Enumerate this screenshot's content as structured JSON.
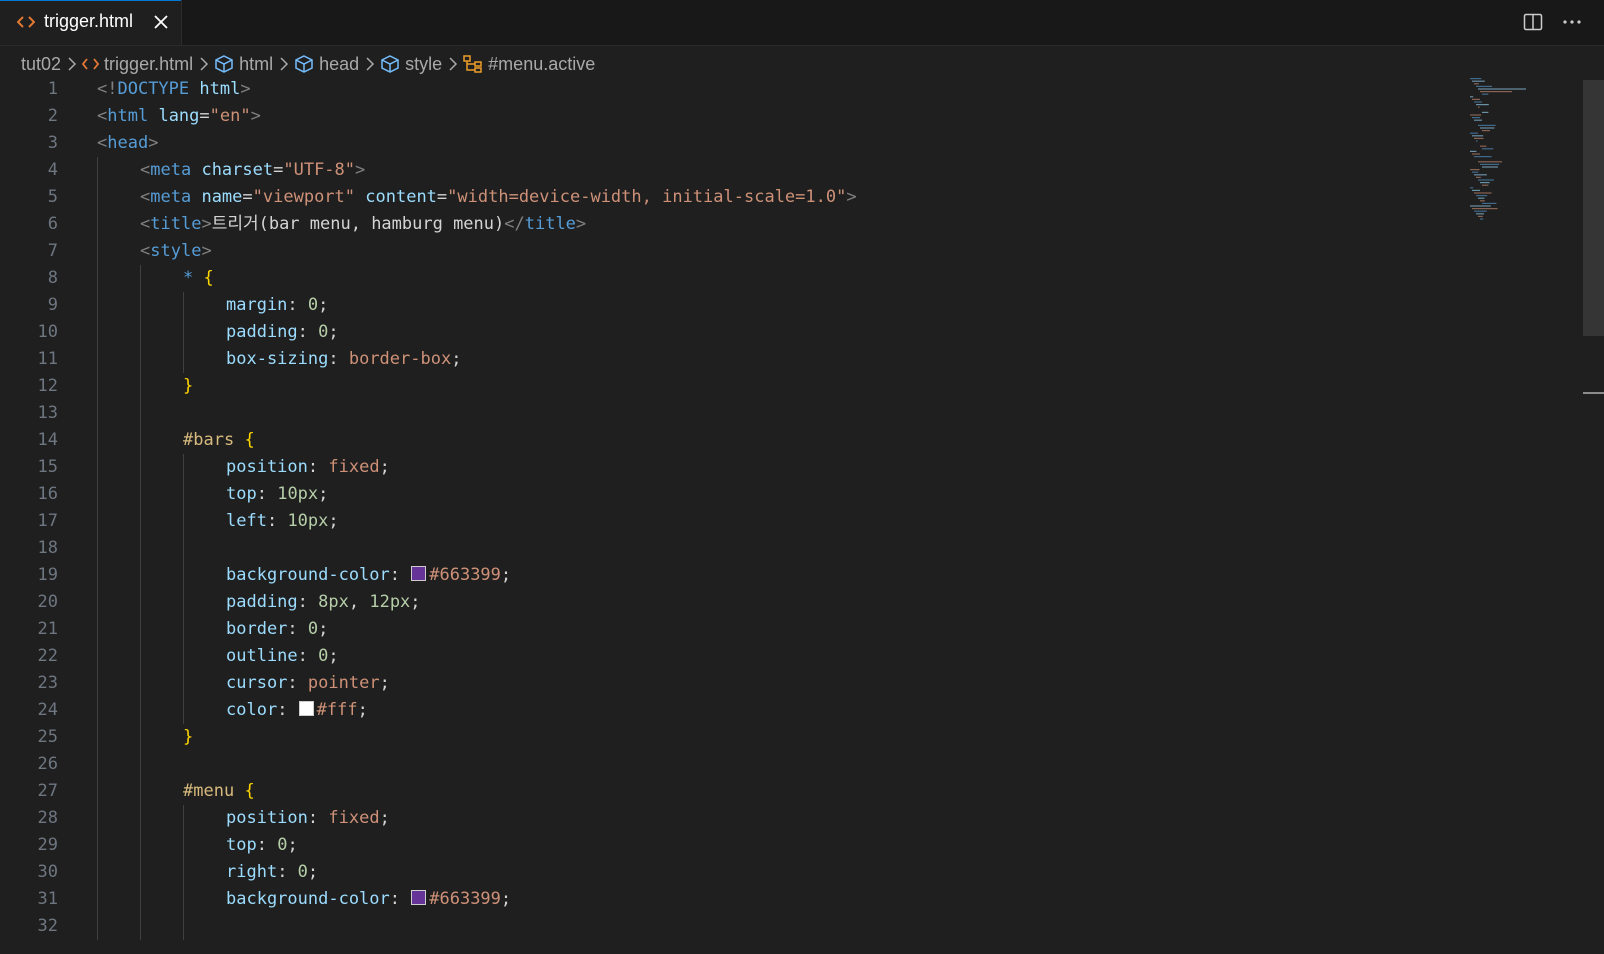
{
  "tab": {
    "filename": "trigger.html",
    "file_icon": "html-file-icon",
    "close_icon": "close-icon"
  },
  "toolbar": {
    "split_icon": "split-editor-icon",
    "more_icon": "more-actions-icon"
  },
  "breadcrumb": [
    {
      "label": "tut02",
      "icon": ""
    },
    {
      "label": "trigger.html",
      "icon": "html-file-icon"
    },
    {
      "label": "html",
      "icon": "element-icon"
    },
    {
      "label": "head",
      "icon": "element-icon"
    },
    {
      "label": "style",
      "icon": "element-icon"
    },
    {
      "label": "#menu.active",
      "icon": "selector-icon"
    }
  ],
  "colors": {
    "editor_bg": "#1f1f1f",
    "tabbar_bg": "#181818",
    "swatch_purple": "#663399",
    "swatch_white": "#ffffff"
  },
  "code_lines": [
    {
      "n": "1",
      "indent": 0,
      "tokens": [
        [
          "t-punc",
          "<!"
        ],
        [
          "t-tag",
          "DOCTYPE"
        ],
        [
          "t-plain",
          " "
        ],
        [
          "t-attr",
          "html"
        ],
        [
          "t-punc",
          ">"
        ]
      ]
    },
    {
      "n": "2",
      "indent": 0,
      "tokens": [
        [
          "t-punc",
          "<"
        ],
        [
          "t-tag",
          "html"
        ],
        [
          "t-plain",
          " "
        ],
        [
          "t-attr",
          "lang"
        ],
        [
          "t-plain",
          "="
        ],
        [
          "t-str",
          "\"en\""
        ],
        [
          "t-punc",
          ">"
        ]
      ]
    },
    {
      "n": "3",
      "indent": 0,
      "tokens": [
        [
          "t-punc",
          "<"
        ],
        [
          "t-tag",
          "head"
        ],
        [
          "t-punc",
          ">"
        ]
      ]
    },
    {
      "n": "4",
      "indent": 1,
      "tokens": [
        [
          "t-punc",
          "<"
        ],
        [
          "t-tag",
          "meta"
        ],
        [
          "t-plain",
          " "
        ],
        [
          "t-attr",
          "charset"
        ],
        [
          "t-plain",
          "="
        ],
        [
          "t-str",
          "\"UTF-8\""
        ],
        [
          "t-punc",
          ">"
        ]
      ]
    },
    {
      "n": "5",
      "indent": 1,
      "tokens": [
        [
          "t-punc",
          "<"
        ],
        [
          "t-tag",
          "meta"
        ],
        [
          "t-plain",
          " "
        ],
        [
          "t-attr",
          "name"
        ],
        [
          "t-plain",
          "="
        ],
        [
          "t-str",
          "\"viewport\""
        ],
        [
          "t-plain",
          " "
        ],
        [
          "t-attr",
          "content"
        ],
        [
          "t-plain",
          "="
        ],
        [
          "t-str",
          "\"width=device-width, initial-scale=1.0\""
        ],
        [
          "t-punc",
          ">"
        ]
      ]
    },
    {
      "n": "6",
      "indent": 1,
      "tokens": [
        [
          "t-punc",
          "<"
        ],
        [
          "t-tag",
          "title"
        ],
        [
          "t-punc",
          ">"
        ],
        [
          "t-text",
          "트리거(bar menu, hamburg menu)"
        ],
        [
          "t-punc",
          "</"
        ],
        [
          "t-tag",
          "title"
        ],
        [
          "t-punc",
          ">"
        ]
      ]
    },
    {
      "n": "7",
      "indent": 1,
      "tokens": [
        [
          "t-punc",
          "<"
        ],
        [
          "t-tag",
          "style"
        ],
        [
          "t-punc",
          ">"
        ]
      ]
    },
    {
      "n": "8",
      "indent": 2,
      "tokens": [
        [
          "t-tag",
          "*"
        ],
        [
          "t-plain",
          " "
        ],
        [
          "t-brace",
          "{"
        ]
      ]
    },
    {
      "n": "9",
      "indent": 3,
      "tokens": [
        [
          "t-prop",
          "margin"
        ],
        [
          "t-plain",
          ": "
        ],
        [
          "t-num",
          "0"
        ],
        [
          "t-plain",
          ";"
        ]
      ]
    },
    {
      "n": "10",
      "indent": 3,
      "tokens": [
        [
          "t-prop",
          "padding"
        ],
        [
          "t-plain",
          ": "
        ],
        [
          "t-num",
          "0"
        ],
        [
          "t-plain",
          ";"
        ]
      ]
    },
    {
      "n": "11",
      "indent": 3,
      "tokens": [
        [
          "t-prop",
          "box-sizing"
        ],
        [
          "t-plain",
          ": "
        ],
        [
          "t-val",
          "border-box"
        ],
        [
          "t-plain",
          ";"
        ]
      ]
    },
    {
      "n": "12",
      "indent": 2,
      "tokens": [
        [
          "t-brace",
          "}"
        ]
      ]
    },
    {
      "n": "13",
      "indent": 2,
      "tokens": []
    },
    {
      "n": "14",
      "indent": 2,
      "tokens": [
        [
          "t-sel",
          "#bars"
        ],
        [
          "t-plain",
          " "
        ],
        [
          "t-brace",
          "{"
        ]
      ]
    },
    {
      "n": "15",
      "indent": 3,
      "tokens": [
        [
          "t-prop",
          "position"
        ],
        [
          "t-plain",
          ": "
        ],
        [
          "t-val",
          "fixed"
        ],
        [
          "t-plain",
          ";"
        ]
      ]
    },
    {
      "n": "16",
      "indent": 3,
      "tokens": [
        [
          "t-prop",
          "top"
        ],
        [
          "t-plain",
          ": "
        ],
        [
          "t-num",
          "10px"
        ],
        [
          "t-plain",
          ";"
        ]
      ]
    },
    {
      "n": "17",
      "indent": 3,
      "tokens": [
        [
          "t-prop",
          "left"
        ],
        [
          "t-plain",
          ": "
        ],
        [
          "t-num",
          "10px"
        ],
        [
          "t-plain",
          ";"
        ]
      ]
    },
    {
      "n": "18",
      "indent": 3,
      "tokens": []
    },
    {
      "n": "19",
      "indent": 3,
      "tokens": [
        [
          "t-prop",
          "background-color"
        ],
        [
          "t-plain",
          ": "
        ],
        [
          "swatch",
          "#663399"
        ],
        [
          "t-val",
          "#663399"
        ],
        [
          "t-plain",
          ";"
        ]
      ]
    },
    {
      "n": "20",
      "indent": 3,
      "tokens": [
        [
          "t-prop",
          "padding"
        ],
        [
          "t-plain",
          ": "
        ],
        [
          "t-num",
          "8px"
        ],
        [
          "t-plain",
          ", "
        ],
        [
          "t-num",
          "12px"
        ],
        [
          "t-plain",
          ";"
        ]
      ]
    },
    {
      "n": "21",
      "indent": 3,
      "tokens": [
        [
          "t-prop",
          "border"
        ],
        [
          "t-plain",
          ": "
        ],
        [
          "t-num",
          "0"
        ],
        [
          "t-plain",
          ";"
        ]
      ]
    },
    {
      "n": "22",
      "indent": 3,
      "tokens": [
        [
          "t-prop",
          "outline"
        ],
        [
          "t-plain",
          ": "
        ],
        [
          "t-num",
          "0"
        ],
        [
          "t-plain",
          ";"
        ]
      ]
    },
    {
      "n": "23",
      "indent": 3,
      "tokens": [
        [
          "t-prop",
          "cursor"
        ],
        [
          "t-plain",
          ": "
        ],
        [
          "t-val",
          "pointer"
        ],
        [
          "t-plain",
          ";"
        ]
      ]
    },
    {
      "n": "24",
      "indent": 3,
      "tokens": [
        [
          "t-prop",
          "color"
        ],
        [
          "t-plain",
          ": "
        ],
        [
          "swatch",
          "#ffffff"
        ],
        [
          "t-val",
          "#fff"
        ],
        [
          "t-plain",
          ";"
        ]
      ]
    },
    {
      "n": "25",
      "indent": 2,
      "tokens": [
        [
          "t-brace",
          "}"
        ]
      ]
    },
    {
      "n": "26",
      "indent": 2,
      "tokens": []
    },
    {
      "n": "27",
      "indent": 2,
      "tokens": [
        [
          "t-sel",
          "#menu"
        ],
        [
          "t-plain",
          " "
        ],
        [
          "t-brace",
          "{"
        ]
      ]
    },
    {
      "n": "28",
      "indent": 3,
      "tokens": [
        [
          "t-prop",
          "position"
        ],
        [
          "t-plain",
          ": "
        ],
        [
          "t-val",
          "fixed"
        ],
        [
          "t-plain",
          ";"
        ]
      ]
    },
    {
      "n": "29",
      "indent": 3,
      "tokens": [
        [
          "t-prop",
          "top"
        ],
        [
          "t-plain",
          ": "
        ],
        [
          "t-num",
          "0"
        ],
        [
          "t-plain",
          ";"
        ]
      ]
    },
    {
      "n": "30",
      "indent": 3,
      "tokens": [
        [
          "t-prop",
          "right"
        ],
        [
          "t-plain",
          ": "
        ],
        [
          "t-num",
          "0"
        ],
        [
          "t-plain",
          ";"
        ]
      ]
    },
    {
      "n": "31",
      "indent": 3,
      "tokens": [
        [
          "t-prop",
          "background-color"
        ],
        [
          "t-plain",
          ": "
        ],
        [
          "swatch",
          "#663399"
        ],
        [
          "t-val",
          "#663399"
        ],
        [
          "t-plain",
          ";"
        ]
      ]
    },
    {
      "n": "32",
      "indent": 3,
      "tokens": []
    }
  ]
}
